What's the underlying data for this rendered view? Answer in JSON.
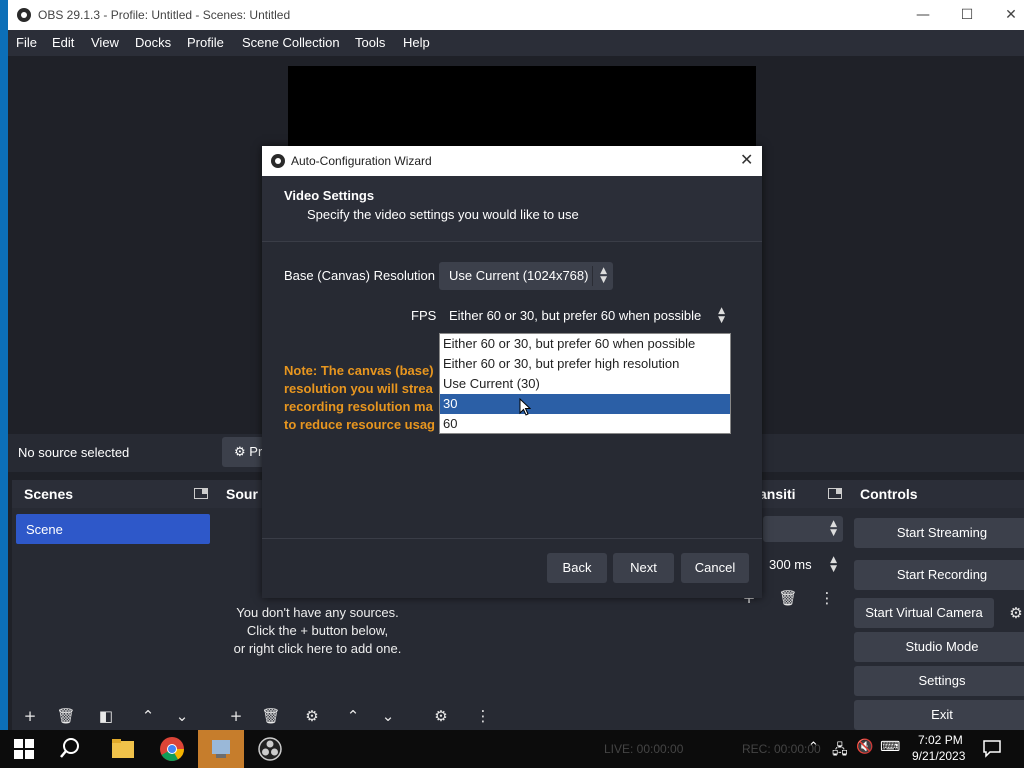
{
  "window": {
    "title": "OBS 29.1.3 - Profile: Untitled - Scenes: Untitled",
    "minimize": "—",
    "maximize": "☐",
    "close": "✕"
  },
  "menu": [
    "File",
    "Edit",
    "View",
    "Docks",
    "Profile",
    "Scene Collection",
    "Tools",
    "Help"
  ],
  "source_bar": {
    "no_source": "No source selected",
    "properties_label": "Pr"
  },
  "docks": {
    "scenes": {
      "title": "Scenes",
      "items": [
        "Scene"
      ]
    },
    "sources": {
      "title": "Sour",
      "empty_lines": [
        "You don't have any sources.",
        "Click the + button below,",
        "or right click here to add one."
      ]
    },
    "transitions": {
      "title": "ansiti",
      "duration": "300 ms"
    },
    "controls": {
      "title": "Controls",
      "buttons": [
        "Start Streaming",
        "Start Recording",
        "Start Virtual Camera",
        "Studio Mode",
        "Settings",
        "Exit"
      ]
    }
  },
  "wizard": {
    "title": "Auto-Configuration Wizard",
    "close": "✕",
    "heading": "Video Settings",
    "subheading": "Specify the video settings you would like to use",
    "resolution_label": "Base (Canvas) Resolution",
    "resolution_value": "Use Current (1024x768)",
    "fps_label": "FPS",
    "fps_value": "Either 60 or 30, but prefer 60 when possible",
    "note": "Note: The canvas (base)\nresolution you will strea\nrecording resolution ma\nto reduce resource usag",
    "buttons": {
      "back": "Back",
      "next": "Next",
      "cancel": "Cancel"
    },
    "fps_options": [
      "Either 60 or 30, but prefer 60 when possible",
      "Either 60 or 30, but prefer high resolution",
      "Use Current (30)",
      "30",
      "60"
    ],
    "fps_highlighted": "30"
  },
  "taskbar": {
    "status_live": "LIVE: 00:00:00",
    "status_rec": "REC: 00:00:00",
    "time": "7:02 PM",
    "date": "9/21/2023"
  },
  "colors": {
    "accent": "#2e58c9",
    "note": "#e8961f",
    "highlight": "#2b5fa6"
  }
}
